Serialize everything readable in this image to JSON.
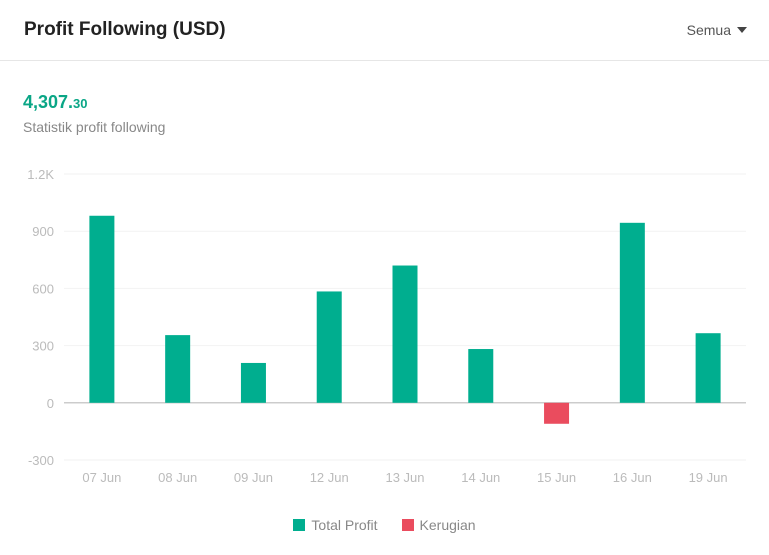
{
  "header": {
    "title": "Profit Following (USD)",
    "filter_label": "Semua"
  },
  "summary": {
    "total_int": "4,307.",
    "total_dec": "30",
    "subtitle": "Statistik profit following"
  },
  "colors": {
    "profit": "#00ae8f",
    "loss": "#ea4c5e"
  },
  "chart_data": {
    "type": "bar",
    "title": "Profit Following (USD)",
    "xlabel": "",
    "ylabel": "",
    "categories": [
      "07 Jun",
      "08 Jun",
      "09 Jun",
      "12 Jun",
      "13 Jun",
      "14 Jun",
      "15 Jun",
      "16 Jun",
      "19 Jun"
    ],
    "series": [
      {
        "name": "Total Profit",
        "values": [
          981,
          355,
          209,
          584,
          720,
          282,
          0,
          944,
          365
        ]
      },
      {
        "name": "Kerugian",
        "values": [
          0,
          0,
          0,
          0,
          0,
          0,
          -110,
          0,
          0
        ]
      }
    ],
    "ylim": [
      -300,
      1200
    ],
    "yticks": [
      -300,
      0,
      300,
      600,
      900,
      1200
    ],
    "ytick_labels": [
      "-300",
      "0",
      "300",
      "600",
      "900",
      "1.2K"
    ],
    "grid": true,
    "legend": [
      "Total Profit",
      "Kerugian"
    ],
    "legend_position": "bottom"
  }
}
